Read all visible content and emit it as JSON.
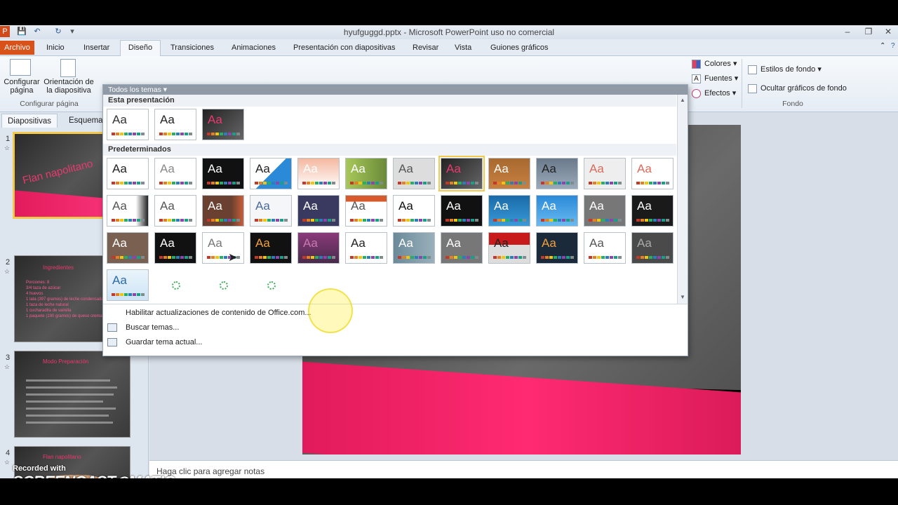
{
  "window": {
    "title": "hyufguggd.pptx - Microsoft PowerPoint uso no comercial",
    "minimize": "–",
    "restore": "❐",
    "close": "✕"
  },
  "quick_access": {
    "app_icon": "P",
    "save": "💾",
    "undo": "↶",
    "redo": "↻",
    "customize": "▾"
  },
  "tabs": {
    "file": "Archivo",
    "items": [
      "Inicio",
      "Insertar",
      "Diseño",
      "Transiciones",
      "Animaciones",
      "Presentación con diapositivas",
      "Revisar",
      "Vista",
      "Guiones gráficos"
    ],
    "active": "Diseño"
  },
  "ribbon": {
    "page_setup": "Configurar página",
    "page_setup_btn": "Configurar página",
    "orientation_btn": "Orientación de la diapositiva",
    "group_label": "Configurar página",
    "colors": "Colores",
    "fonts": "Fuentes",
    "effects": "Efectos",
    "bg_styles": "Estilos de fondo",
    "hide_bg": "Ocultar gráficos de fondo",
    "bg_group": "Fondo"
  },
  "left_pane": {
    "tab_slides": "Diapositivas",
    "tab_outline": "Esquema",
    "slides": [
      {
        "num": "1",
        "title": "Flan napolitano"
      },
      {
        "num": "2",
        "title": "Ingredientes"
      },
      {
        "num": "3",
        "title": "Modo Preparación"
      },
      {
        "num": "4",
        "title": "Flan napolitano"
      }
    ],
    "slide2_text": [
      "Porciones: 8",
      "3/4 taza de azúcar",
      "4 huevos",
      "1 lata (397 gramos) de leche condensada",
      "1 taza de leche natural",
      "1 cucharadita de vainilla",
      "1 paquete (190 gramos) de queso crema"
    ]
  },
  "gallery": {
    "header": "Todos los temas",
    "section_current": "Esta presentación",
    "section_builtin": "Predeterminados",
    "theme_label": "Aa",
    "commands": [
      "Habilitar actualizaciones de contenido de Office.com...",
      "Buscar temas...",
      "Guardar tema actual..."
    ]
  },
  "notes": {
    "placeholder": "Haga clic para agregar notas"
  },
  "watermark": {
    "line1": "Recorded with",
    "line2": "SCREENCAST◉MATIC"
  },
  "colors": {
    "accent_file": "#d8521a",
    "slide_band": "#ff2a72",
    "highlight": "#f2c94c"
  }
}
